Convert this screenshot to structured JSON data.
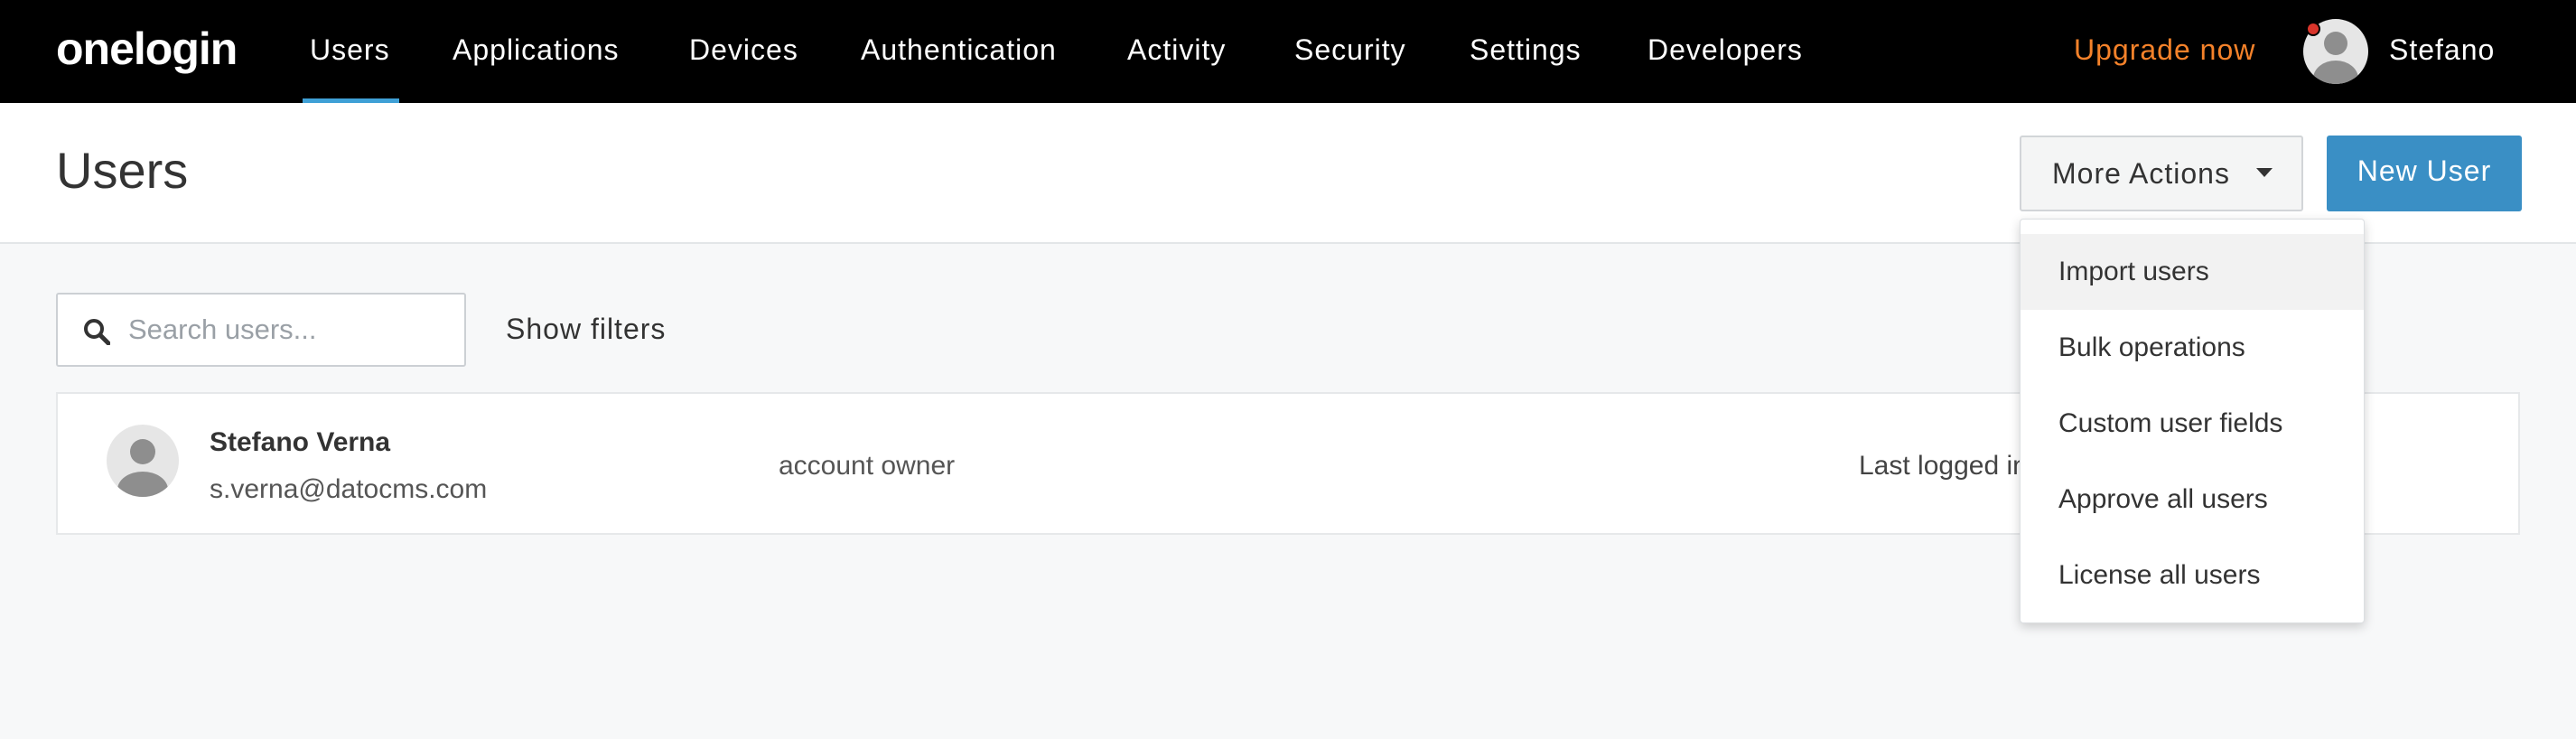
{
  "app": {
    "logo_text": "onelogin"
  },
  "nav": {
    "items": [
      {
        "label": "Users",
        "active": true
      },
      {
        "label": "Applications"
      },
      {
        "label": "Devices"
      },
      {
        "label": "Authentication"
      },
      {
        "label": "Activity"
      },
      {
        "label": "Security"
      },
      {
        "label": "Settings"
      },
      {
        "label": "Developers"
      }
    ],
    "upgrade_label": "Upgrade now",
    "user_name": "Stefano"
  },
  "header": {
    "title": "Users",
    "more_actions_label": "More Actions",
    "new_user_label": "New User"
  },
  "search": {
    "placeholder": "Search users...",
    "value": "",
    "show_filters_label": "Show filters"
  },
  "users": [
    {
      "name": "Stefano Verna",
      "email": "s.verna@datocms.com",
      "role": "account owner",
      "last_login": "Last logged in"
    }
  ],
  "dropdown": {
    "items": [
      {
        "label": "Import users",
        "hovered": true
      },
      {
        "label": "Bulk operations"
      },
      {
        "label": "Custom user fields"
      },
      {
        "label": "Approve all users"
      },
      {
        "label": "License all users"
      }
    ]
  },
  "colors": {
    "nav_bg": "#000000",
    "active_underline": "#3fa0d6",
    "upgrade": "#f5822a",
    "primary_button": "#3a8fc5",
    "notification": "#d9352b"
  }
}
